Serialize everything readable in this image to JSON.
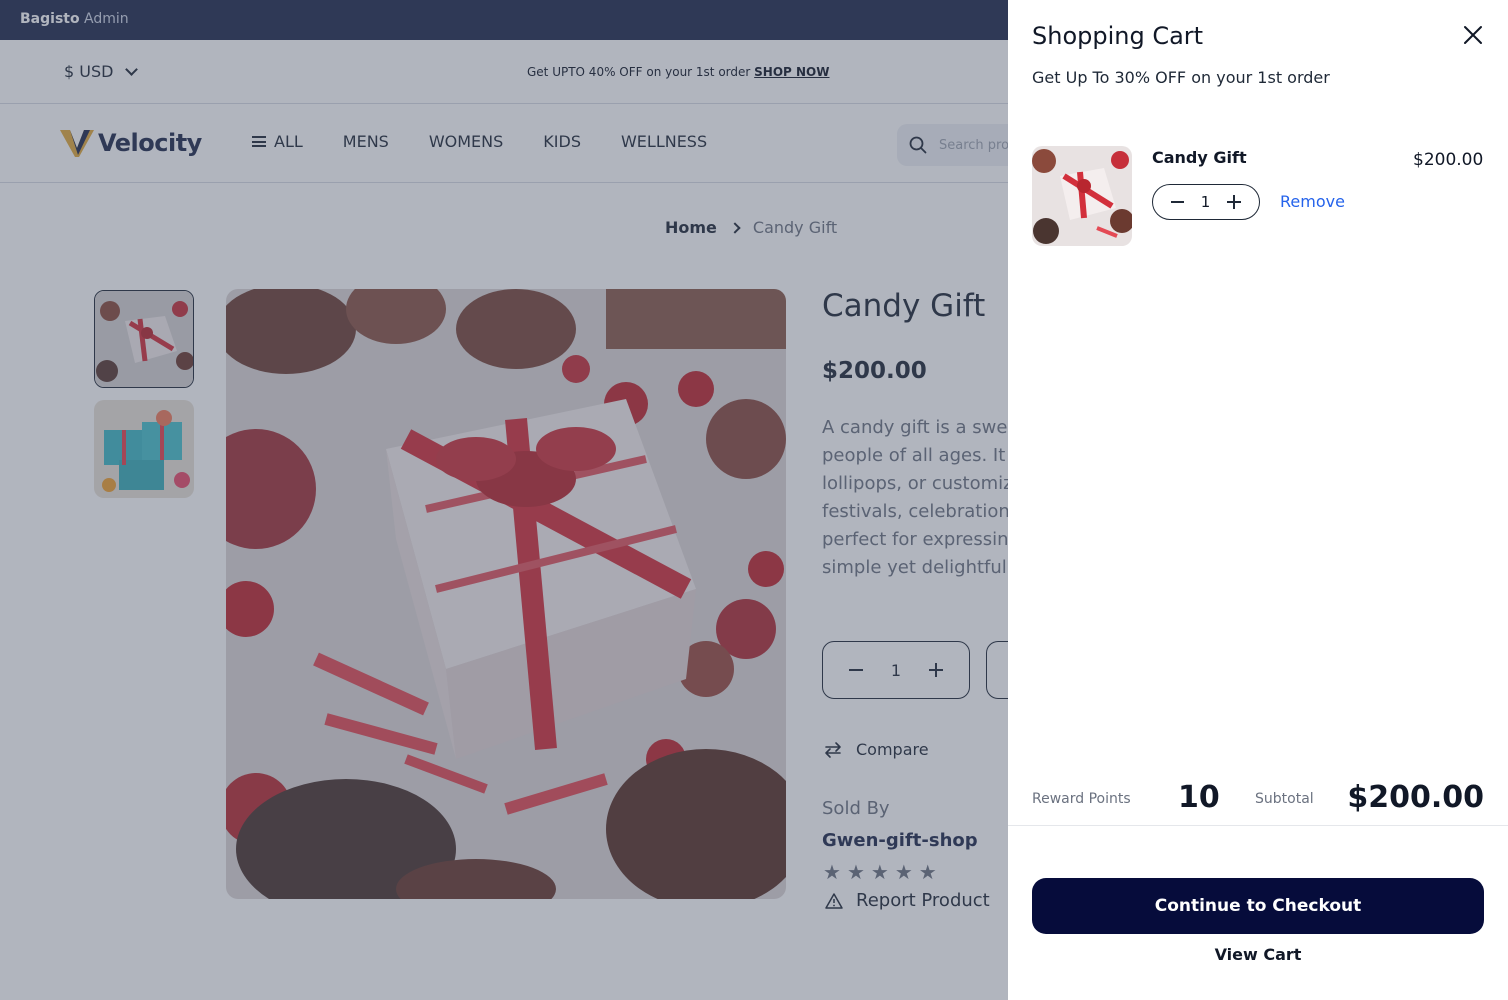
{
  "admin_bar": {
    "brand": "Bagisto",
    "sub": "Admin"
  },
  "header": {
    "currency": "$ USD",
    "promo_text": "Get UPTO 40% OFF on your 1st order",
    "promo_link": "SHOP NOW",
    "logo_text": "Velocity",
    "nav_items": [
      "ALL",
      "MENS",
      "WOMENS",
      "KIDS",
      "WELLNESS"
    ],
    "search_placeholder": "Search products here"
  },
  "breadcrumb": {
    "home": "Home",
    "current": "Candy Gift"
  },
  "product": {
    "title": "Candy Gift",
    "price": "$200.00",
    "description_lines": [
      "A candy gift is a sweet",
      "people of all ages. It c",
      "lollipops, or customiz",
      "festivals, celebration",
      "perfect for expressing",
      "simple yet delightful"
    ],
    "quantity": "1",
    "compare_label": "Compare",
    "sold_by_label": "Sold By",
    "seller": "Gwen-gift-shop",
    "rating_stars": 5,
    "report_label": "Report Product"
  },
  "cart": {
    "title": "Shopping Cart",
    "subtitle": "Get Up To 30% OFF on your 1st order",
    "items": [
      {
        "name": "Candy Gift",
        "price": "$200.00",
        "quantity": "1",
        "remove_label": "Remove"
      }
    ],
    "reward_points_label": "Reward Points",
    "reward_points_value": "10",
    "subtotal_label": "Subtotal",
    "subtotal_value": "$200.00",
    "checkout_label": "Continue to Checkout",
    "view_cart_label": "View Cart"
  },
  "colors": {
    "admin_bar": "#1f2a4d",
    "checkout_button": "#060c3b",
    "remove_link": "#2563eb",
    "overlay": "#464e64"
  },
  "icons": [
    "chevron-down-icon",
    "menu-icon",
    "search-icon",
    "chevron-right-icon",
    "minus-icon",
    "plus-icon",
    "compare-icon",
    "star-icon",
    "warning-icon",
    "close-icon"
  ]
}
